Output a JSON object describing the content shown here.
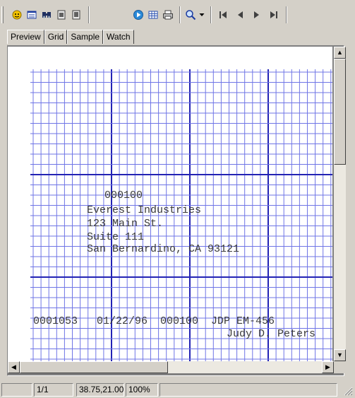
{
  "toolbar": {
    "icons": [
      "wizard-icon",
      "list-icon",
      "find-icon",
      "copy-icon",
      "page-icon",
      "run-icon",
      "table-icon",
      "print-icon",
      "zoom-icon",
      "first-page-icon",
      "prev-page-icon",
      "next-page-icon",
      "last-page-icon"
    ]
  },
  "tabs": [
    "Preview",
    "Grid",
    "Sample",
    "Watch"
  ],
  "page": {
    "address_lines": [
      "000100",
      "Everest Industries",
      "123 Main St.",
      "Suite 111",
      "San Bernardino, CA 93121"
    ],
    "footer_line": "0001053   01/22/96  000100  JDP EM-456",
    "signature": "Judy D. Peters"
  },
  "status": {
    "page": "1/1",
    "coords": "38.75,21.00",
    "zoom": "100%"
  },
  "colors": {
    "grid_minor": "#6f75e6",
    "grid_major": "#2323b4",
    "text": "#3a3a3a"
  }
}
